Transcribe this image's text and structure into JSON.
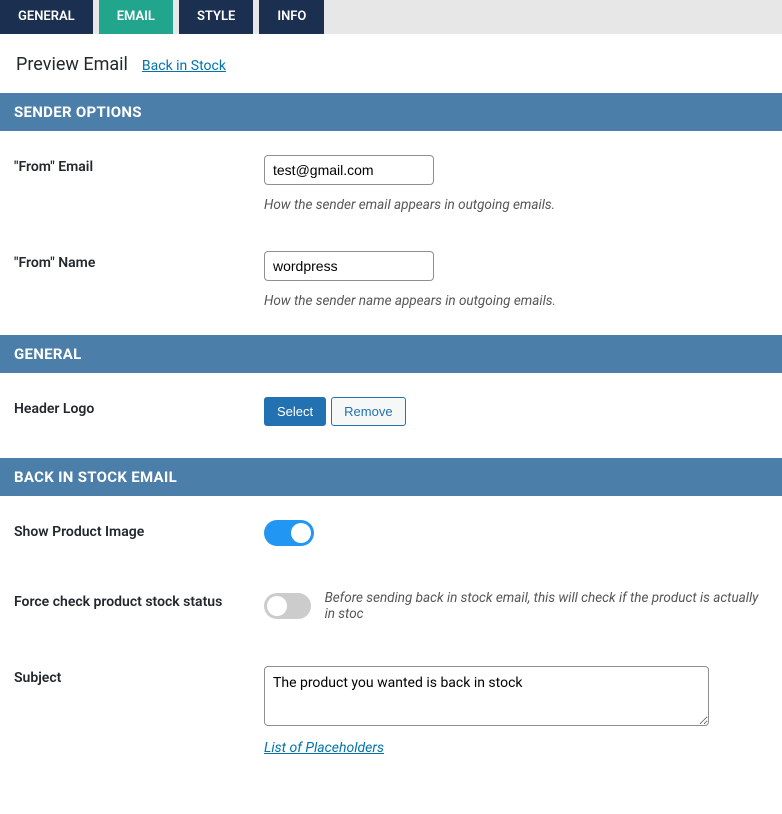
{
  "tabs": [
    {
      "label": "GENERAL",
      "active": false
    },
    {
      "label": "EMAIL",
      "active": true
    },
    {
      "label": "STYLE",
      "active": false
    },
    {
      "label": "INFO",
      "active": false
    }
  ],
  "preview": {
    "title": "Preview Email",
    "link": "Back in Stock"
  },
  "sections": {
    "sender_options": "SENDER OPTIONS",
    "general": "GENERAL",
    "back_in_stock": "BACK IN STOCK EMAIL"
  },
  "from_email": {
    "label": "\"From\" Email",
    "value": "test@gmail.com",
    "help": "How the sender email appears in outgoing emails."
  },
  "from_name": {
    "label": "\"From\" Name",
    "value": "wordpress",
    "help": "How the sender name appears in outgoing emails."
  },
  "header_logo": {
    "label": "Header Logo",
    "select_btn": "Select",
    "remove_btn": "Remove"
  },
  "show_product_image": {
    "label": "Show Product Image",
    "value": true
  },
  "force_check": {
    "label": "Force check product stock status",
    "value": false,
    "help": "Before sending back in stock email, this will check if the product is actually in stoc"
  },
  "subject": {
    "label": "Subject",
    "value": "The product you wanted is back in stock",
    "placeholders_link": "List of Placeholders"
  }
}
